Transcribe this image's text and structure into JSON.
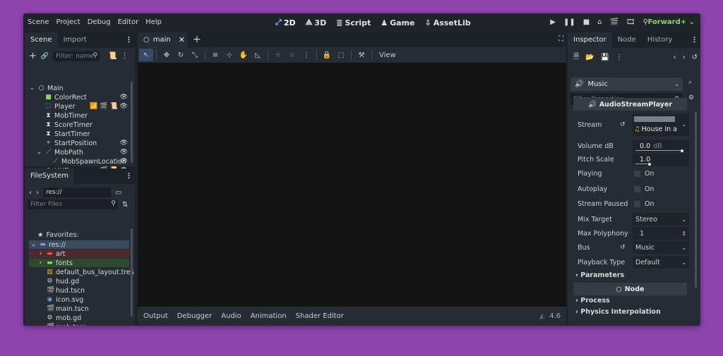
{
  "menu": [
    "Scene",
    "Project",
    "Debug",
    "Editor",
    "Help"
  ],
  "workspaces": [
    {
      "glyph": "⤢",
      "label": "2D",
      "active": true
    },
    {
      "glyph": "⟁",
      "label": "3D",
      "active": false
    },
    {
      "glyph": "≣",
      "label": "Script",
      "active": false
    },
    {
      "glyph": "♟",
      "label": "Game",
      "active": false
    },
    {
      "glyph": "⇩",
      "label": "AssetLib",
      "active": false
    }
  ],
  "renderer": "Forward+",
  "scene_dock": {
    "tabs": [
      "Scene",
      "Import"
    ],
    "filter_placeholder": "Filter: name",
    "nodes": [
      {
        "name": "Main",
        "icon": "○",
        "color": "#e0e0e0",
        "indent": 0,
        "arrow": "⌄",
        "extras": ""
      },
      {
        "name": "ColorRect",
        "icon": "■",
        "color": "#8fd36c",
        "indent": 1,
        "arrow": "",
        "extras": "👁"
      },
      {
        "name": "Player",
        "icon": "⛶",
        "color": "#8ab4ff",
        "indent": 1,
        "arrow": "",
        "extras": "📶 🎬 📜 👁"
      },
      {
        "name": "MobTimer",
        "icon": "⧗",
        "color": "#e0e0e0",
        "indent": 1,
        "arrow": "",
        "extras": ""
      },
      {
        "name": "ScoreTimer",
        "icon": "⧗",
        "color": "#e0e0e0",
        "indent": 1,
        "arrow": "",
        "extras": ""
      },
      {
        "name": "StartTimer",
        "icon": "⧗",
        "color": "#e0e0e0",
        "indent": 1,
        "arrow": "",
        "extras": ""
      },
      {
        "name": "StartPosition",
        "icon": "⌖",
        "color": "#8ab4ff",
        "indent": 1,
        "arrow": "",
        "extras": "👁"
      },
      {
        "name": "MobPath",
        "icon": "⟋",
        "color": "#8ab4ff",
        "indent": 1,
        "arrow": "⌄",
        "extras": "👁"
      },
      {
        "name": "MobSpawnLocation",
        "icon": "⟋",
        "color": "#8ab4ff",
        "indent": 2,
        "arrow": "",
        "extras": "👁"
      },
      {
        "name": "HUD",
        "icon": "⊘",
        "color": "#e0e0e0",
        "indent": 1,
        "arrow": "",
        "extras": "🎬 📜 👁"
      }
    ]
  },
  "filesystem": {
    "tab": "FileSystem",
    "path": "res://",
    "filter_placeholder": "Filter Files",
    "favorites": "Favorites:",
    "items": [
      {
        "name": "res://",
        "icon": "▬",
        "color": "#6aa0e8",
        "arrow": "⌄",
        "indent": 0,
        "bg": "#3a4a5c"
      },
      {
        "name": "art",
        "icon": "▬",
        "color": "#e05252",
        "arrow": "›",
        "indent": 1,
        "bg": "#4a2a2e"
      },
      {
        "name": "fonts",
        "icon": "▬",
        "color": "#8fd36c",
        "arrow": "›",
        "indent": 1,
        "bg": "#2e4a2e"
      },
      {
        "name": "default_bus_layout.tres",
        "icon": "▥",
        "color": "#e8b84a",
        "arrow": "",
        "indent": 1,
        "bg": ""
      },
      {
        "name": "hud.gd",
        "icon": "⚙",
        "color": "#cdcfd2",
        "arrow": "",
        "indent": 1,
        "bg": ""
      },
      {
        "name": "hud.tscn",
        "icon": "🎬",
        "color": "#cdcfd2",
        "arrow": "",
        "indent": 1,
        "bg": ""
      },
      {
        "name": "icon.svg",
        "icon": "◉",
        "color": "#6aa0e8",
        "arrow": "",
        "indent": 1,
        "bg": ""
      },
      {
        "name": "main.tscn",
        "icon": "🎬",
        "color": "#cdcfd2",
        "arrow": "",
        "indent": 1,
        "bg": ""
      },
      {
        "name": "mob.gd",
        "icon": "⚙",
        "color": "#cdcfd2",
        "arrow": "",
        "indent": 1,
        "bg": ""
      },
      {
        "name": "mob.tscn",
        "icon": "🎬",
        "color": "#cdcfd2",
        "arrow": "",
        "indent": 1,
        "bg": ""
      }
    ]
  },
  "editor_tab": "main",
  "view_button": "View",
  "bottom_panel": [
    "Output",
    "Debugger",
    "Audio",
    "Animation",
    "Shader Editor"
  ],
  "version": "4.6",
  "inspector": {
    "tabs": [
      "Inspector",
      "Node",
      "History"
    ],
    "selected_node": "Music",
    "filter_placeholder": "Filter Properties",
    "class_name": "AudioStreamPlayer",
    "stream": {
      "label": "Stream",
      "value": "House In a"
    },
    "volume": {
      "label": "Volume dB",
      "value": "0.0",
      "unit": "dB"
    },
    "pitch": {
      "label": "Pitch Scale",
      "value": "1.0"
    },
    "playing": {
      "label": "Playing",
      "value": "On"
    },
    "autoplay": {
      "label": "Autoplay",
      "value": "On"
    },
    "stream_paused": {
      "label": "Stream Paused",
      "value": "On"
    },
    "mix_target": {
      "label": "Mix Target",
      "value": "Stereo"
    },
    "max_polyphony": {
      "label": "Max Polyphony",
      "value": "1"
    },
    "bus": {
      "label": "Bus",
      "value": "Music"
    },
    "playback_type": {
      "label": "Playback Type",
      "value": "Default"
    },
    "parameters": "Parameters",
    "node_section": "Node",
    "process": "Process",
    "physics_interp": "Physics Interpolation"
  }
}
